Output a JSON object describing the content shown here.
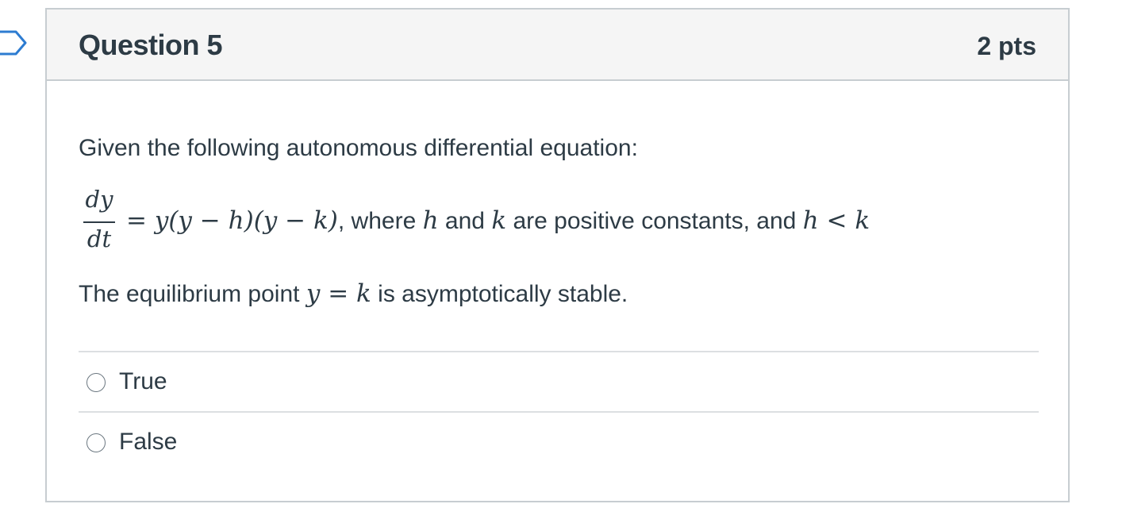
{
  "question": {
    "title": "Question 5",
    "points": "2 pts",
    "intro": "Given the following autonomous differential equation:",
    "equation": {
      "numerator": "dy",
      "denominator": "dt",
      "rhs": "= y(y − h)(y − k)",
      "comma": ",",
      "where": " where ",
      "var_h": "h",
      "and1": " and ",
      "var_k": "k",
      "are_positive": " are positive constants, and ",
      "inequality": "h < k"
    },
    "statement": {
      "prefix": "The equilibrium point ",
      "math": "y = k",
      "suffix": " is asymptotically stable."
    }
  },
  "answers": [
    {
      "label": "True",
      "selected": false
    },
    {
      "label": "False",
      "selected": false
    }
  ],
  "icons": {
    "flag": "bookmark-flag-icon",
    "radio": "radio-unchecked-icon"
  },
  "colors": {
    "text": "#2d3b45",
    "header_bg": "#f5f5f5",
    "border": "#c7cdd1",
    "flag": "#2d7cd1"
  }
}
